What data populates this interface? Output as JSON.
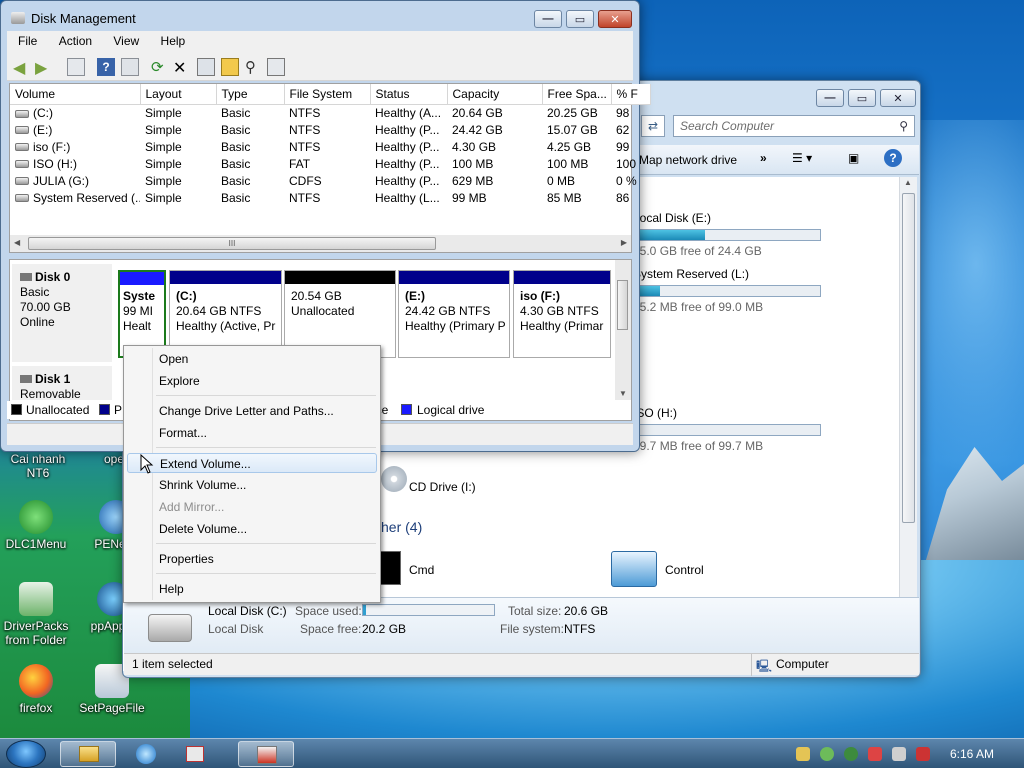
{
  "disk_management": {
    "title": "Disk Management",
    "menu": [
      "File",
      "Action",
      "View",
      "Help"
    ],
    "columns": [
      "Volume",
      "Layout",
      "Type",
      "File System",
      "Status",
      "Capacity",
      "Free Spa...",
      "% F"
    ],
    "volumes": [
      {
        "volume": "(C:)",
        "layout": "Simple",
        "type": "Basic",
        "fs": "NTFS",
        "status": "Healthy (A...",
        "capacity": "20.64 GB",
        "free": "20.25 GB",
        "pct": "98"
      },
      {
        "volume": "(E:)",
        "layout": "Simple",
        "type": "Basic",
        "fs": "NTFS",
        "status": "Healthy (P...",
        "capacity": "24.42 GB",
        "free": "15.07 GB",
        "pct": "62"
      },
      {
        "volume": "iso (F:)",
        "layout": "Simple",
        "type": "Basic",
        "fs": "NTFS",
        "status": "Healthy (P...",
        "capacity": "4.30 GB",
        "free": "4.25 GB",
        "pct": "99"
      },
      {
        "volume": "ISO (H:)",
        "layout": "Simple",
        "type": "Basic",
        "fs": "FAT",
        "status": "Healthy (P...",
        "capacity": "100 MB",
        "free": "100 MB",
        "pct": "100"
      },
      {
        "volume": "JULIA (G:)",
        "layout": "Simple",
        "type": "Basic",
        "fs": "CDFS",
        "status": "Healthy (P...",
        "capacity": "629 MB",
        "free": "0 MB",
        "pct": "0 %"
      },
      {
        "volume": "System Reserved (...",
        "layout": "Simple",
        "type": "Basic",
        "fs": "NTFS",
        "status": "Healthy (L...",
        "capacity": "99 MB",
        "free": "85 MB",
        "pct": "86"
      }
    ],
    "scroll_grip": "III",
    "disk0": {
      "name": "Disk 0",
      "type": "Basic",
      "size": "70.00 GB",
      "state": "Online",
      "partitions": [
        {
          "line1": "Syste",
          "line2": "99 MI",
          "line3": "Healt",
          "band": "#1a1aff"
        },
        {
          "line1": "(C:)",
          "line2": "20.64 GB NTFS",
          "line3": "Healthy (Active, Pr",
          "band": "#00008b"
        },
        {
          "line1": "",
          "line2": "20.54 GB",
          "line3": "Unallocated",
          "band": "#000000"
        },
        {
          "line1": "(E:)",
          "line2": "24.42 GB NTFS",
          "line3": "Healthy (Primary P",
          "band": "#00008b"
        },
        {
          "line1": "iso  (F:)",
          "line2": "4.30 GB NTFS",
          "line3": "Healthy (Primar",
          "band": "#00008b"
        }
      ]
    },
    "disk1": {
      "name": "Disk 1",
      "type": "Removable"
    },
    "legend": [
      {
        "label": "Unallocated",
        "color": "#000000"
      },
      {
        "label": "P",
        "color": "#00008b"
      },
      {
        "label": "ace",
        "color": ""
      },
      {
        "label": "Logical drive",
        "color": "#1a1aff"
      }
    ]
  },
  "context_menu": {
    "items": [
      "Open",
      "Explore",
      "Change Drive Letter and Paths...",
      "Format...",
      "Extend Volume...",
      "Shrink Volume...",
      "Add Mirror...",
      "Delete Volume...",
      "Properties",
      "Help"
    ],
    "highlighted": "Extend Volume...",
    "disabled": [
      "Add Mirror..."
    ]
  },
  "explorer": {
    "search_placeholder": "Search Computer",
    "toolbar_map_drive": "Map network drive",
    "toolbar_more": "»",
    "drives": [
      {
        "name": "Local Disk (E:)",
        "free": "15.0 GB free of 24.4 GB",
        "used_fraction": 0.38
      },
      {
        "name": "System Reserved (L:)",
        "free": "85.2 MB free of 99.0 MB",
        "used_fraction": 0.14
      },
      {
        "name": "ISO (H:)",
        "free": "99.7 MB free of 99.7 MB",
        "used_fraction": 0.0
      }
    ],
    "cd_drive": "CD Drive (I:)",
    "other_heading": "her (4)",
    "other_items": [
      "Cmd",
      "Control"
    ],
    "details": {
      "name": "Local Disk (C:)",
      "type": "Local Disk",
      "space_used_label": "Space used:",
      "space_used_fraction": 0.02,
      "space_free_label": "Space free:",
      "space_free": "20.2 GB",
      "total_size_label": "Total size:",
      "total_size": "20.6 GB",
      "fs_label": "File system:",
      "fs": "NTFS"
    },
    "status_selected": "1 item selected",
    "status_location": "Computer"
  },
  "desktop_icons": [
    "Cai nhanh NT6",
    "oper",
    "DLC1Menu",
    "PENetw",
    "DriverPacks from Folder",
    "ppAppsv",
    "firefox",
    "SetPageFile"
  ],
  "taskbar": {
    "clock": "6:16 AM"
  }
}
